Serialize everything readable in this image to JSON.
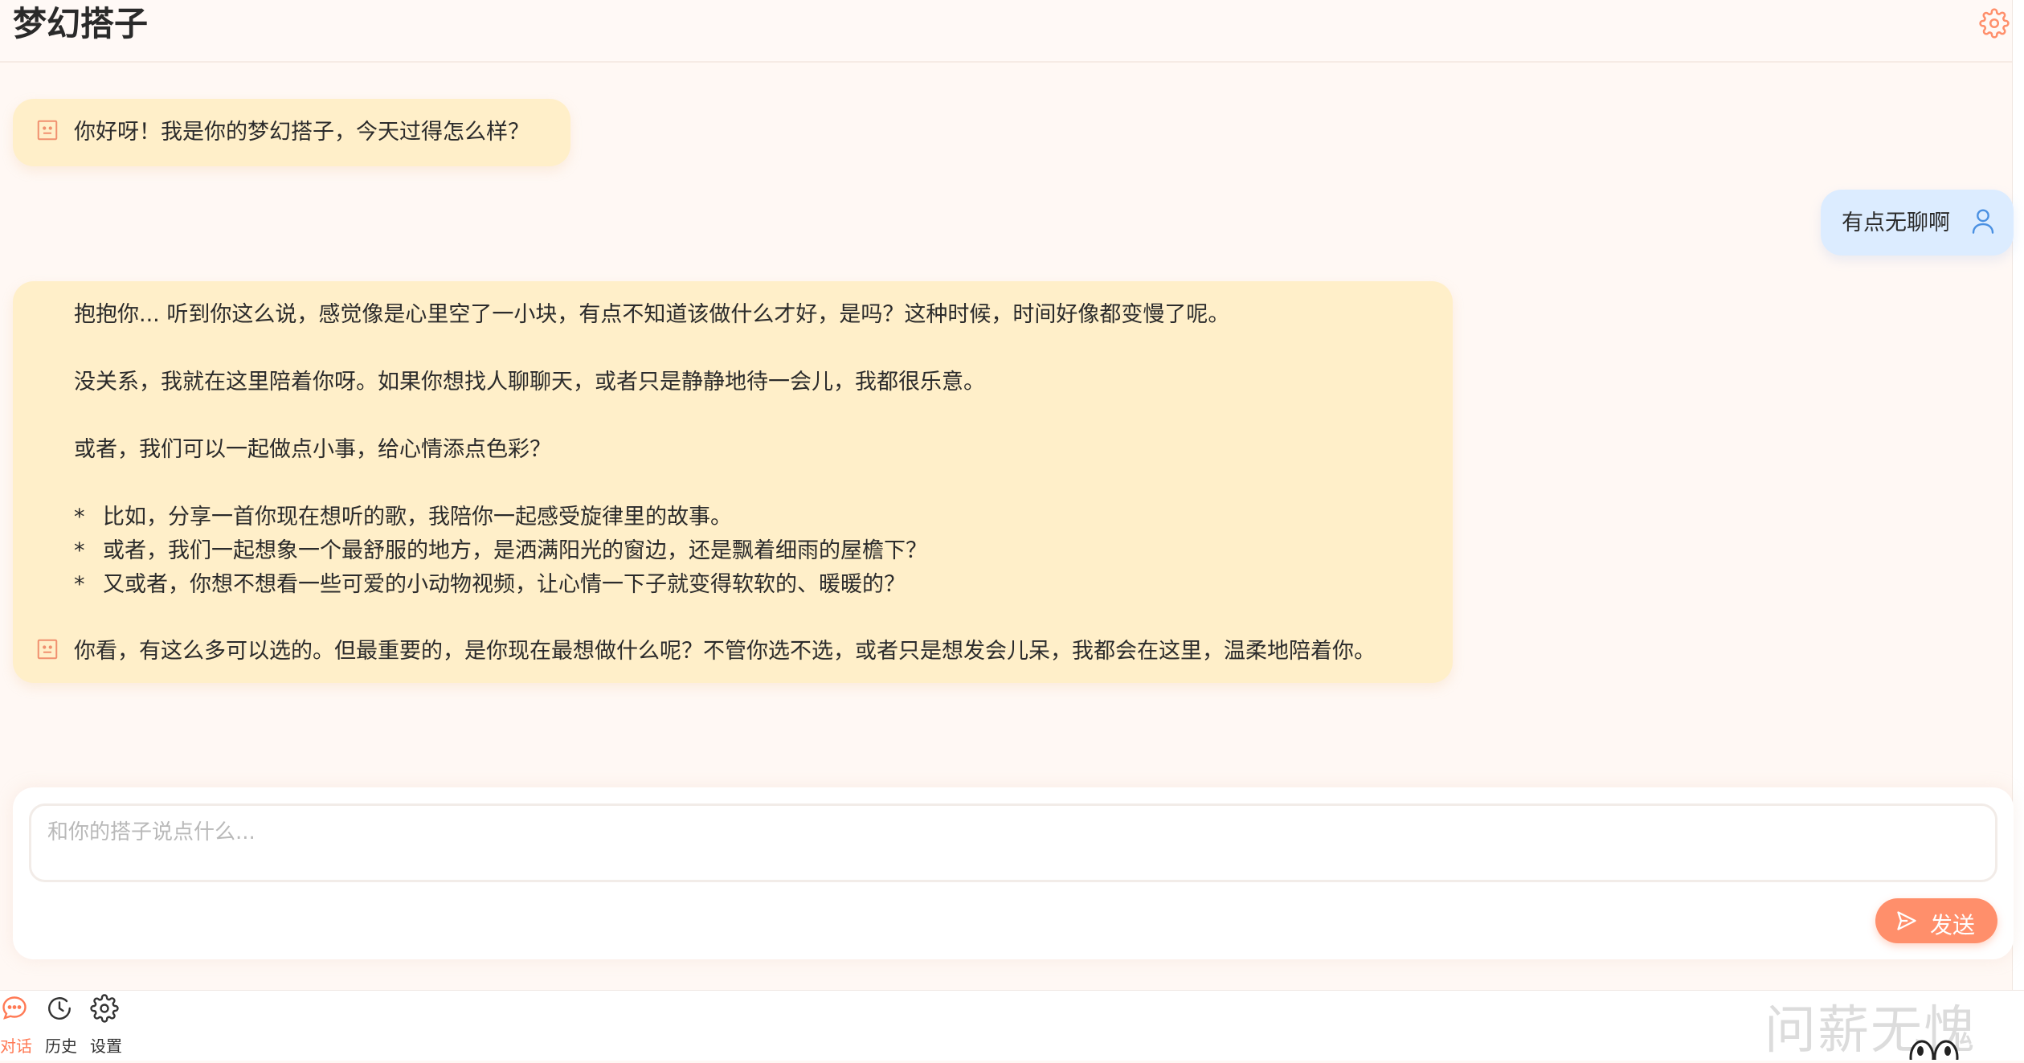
{
  "app": {
    "title": "梦幻搭子"
  },
  "messages": {
    "greeting": "你好呀！我是你的梦幻搭子，今天过得怎么样？",
    "user_message": "有点无聊啊",
    "reply": {
      "p1": "抱抱你... 听到你这么说，感觉像是心里空了一小块，有点不知道该做什么才好，是吗？这种时候，时间好像都变慢了呢。",
      "p2": "没关系，我就在这里陪着你呀。如果你想找人聊聊天，或者只是静静地待一会儿，我都很乐意。",
      "p3": "或者，我们可以一起做点小事，给心情添点色彩？",
      "bullets": [
        "比如，分享一首你现在想听的歌，我陪你一起感受旋律里的故事。",
        "或者，我们一起想象一个最舒服的地方，是洒满阳光的窗边，还是飘着细雨的屋檐下？",
        "又或者，你想不想看一些可爱的小动物视频，让心情一下子就变得软软的、暖暖的？"
      ],
      "bullet_marker": "*",
      "p4": "你看，有这么多可以选的。但最重要的，是你现在最想做什么呢？不管你选不选，或者只是想发会儿呆，我都会在这里，温柔地陪着你。"
    }
  },
  "composer": {
    "placeholder": "和你的搭子说点什么...",
    "value": "",
    "send_label": "发送"
  },
  "nav": {
    "items": [
      {
        "label": "对话",
        "icon": "chat-bubble-icon",
        "active": true
      },
      {
        "label": "历史",
        "icon": "clock-icon",
        "active": false
      },
      {
        "label": "设置",
        "icon": "gear-icon",
        "active": false
      }
    ]
  },
  "watermark": "问薪无愧",
  "colors": {
    "accent": "#ff8f6b",
    "bot_bubble": "#ffefc9",
    "user_bubble": "#dcecff",
    "background": "#fff8f4"
  }
}
